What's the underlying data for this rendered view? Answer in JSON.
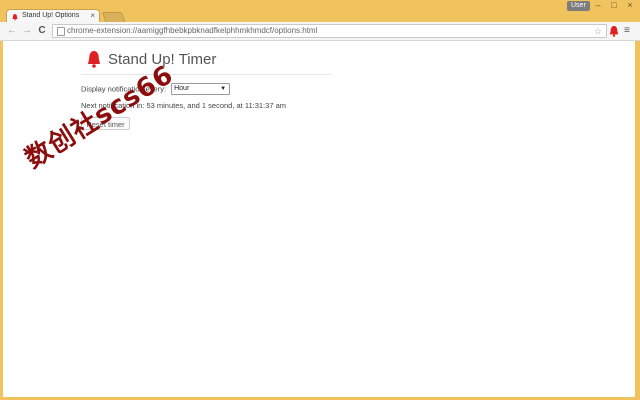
{
  "browser": {
    "tab": {
      "title": "Stand Up! Options",
      "close_glyph": "×"
    },
    "user_label": "User",
    "window_controls": {
      "minimize": "–",
      "maximize": "□",
      "close": "×"
    },
    "nav": {
      "back": "←",
      "forward": "→",
      "reload": "C"
    },
    "url": "chrome-extension://aamiggfhbebkpbknadfkelphhmkhmdcf/options.html",
    "star": "☆",
    "menu_glyph": "≡"
  },
  "page": {
    "title": "Stand Up! Timer",
    "interval_label": "Display notification every:",
    "interval_value": "Hour",
    "next_notification": "Next notification in: 53 minutes, and 1 second, at 11:31:37 am",
    "reset_label": "Reset timer"
  },
  "watermark": "数创社scs66",
  "colors": {
    "frame": "#f1c35e",
    "bell": "#e02020",
    "watermark": "#8c0d0d"
  },
  "icons": [
    "bell-icon",
    "page-icon",
    "star-icon",
    "menu-icon"
  ]
}
